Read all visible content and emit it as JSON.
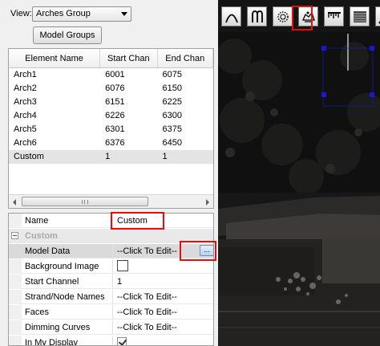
{
  "view": {
    "label": "View:",
    "selected": "Arches Group"
  },
  "buttons": {
    "model_groups": "Model Groups"
  },
  "grid": {
    "headers": [
      "Element Name",
      "Start Chan",
      "End Chan"
    ],
    "rows": [
      {
        "name": "Arch1",
        "start": "6001",
        "end": "6075"
      },
      {
        "name": "Arch2",
        "start": "6076",
        "end": "6150"
      },
      {
        "name": "Arch3",
        "start": "6151",
        "end": "6225"
      },
      {
        "name": "Arch4",
        "start": "6226",
        "end": "6300"
      },
      {
        "name": "Arch5",
        "start": "6301",
        "end": "6375"
      },
      {
        "name": "Arch6",
        "start": "6376",
        "end": "6450"
      },
      {
        "name": "Custom",
        "start": "1",
        "end": "1"
      }
    ]
  },
  "props": {
    "name_label": "Name",
    "name_value": "Custom",
    "category": "Custom",
    "model_data_label": "Model Data",
    "model_data_value": "--Click To Edit--",
    "ellipsis": "...",
    "bg_image_label": "Background Image",
    "start_channel_label": "Start Channel",
    "start_channel_value": "1",
    "strand_label": "Strand/Node Names",
    "strand_value": "--Click To Edit--",
    "faces_label": "Faces",
    "faces_value": "--Click To Edit--",
    "dimming_label": "Dimming Curves",
    "dimming_value": "--Click To Edit--",
    "in_display_label": "In My Display",
    "in_display_checked": true
  },
  "toolbar": {
    "icons": [
      "arch-icon",
      "candy-cane-icon",
      "circle-icon",
      "custom-icon",
      "icicles-icon",
      "matrix-icon",
      "line-icon"
    ],
    "active": "custom-icon"
  },
  "colors": {
    "highlight": "#e01010",
    "handles": "#1717d8",
    "preview_bg": "#141414"
  }
}
